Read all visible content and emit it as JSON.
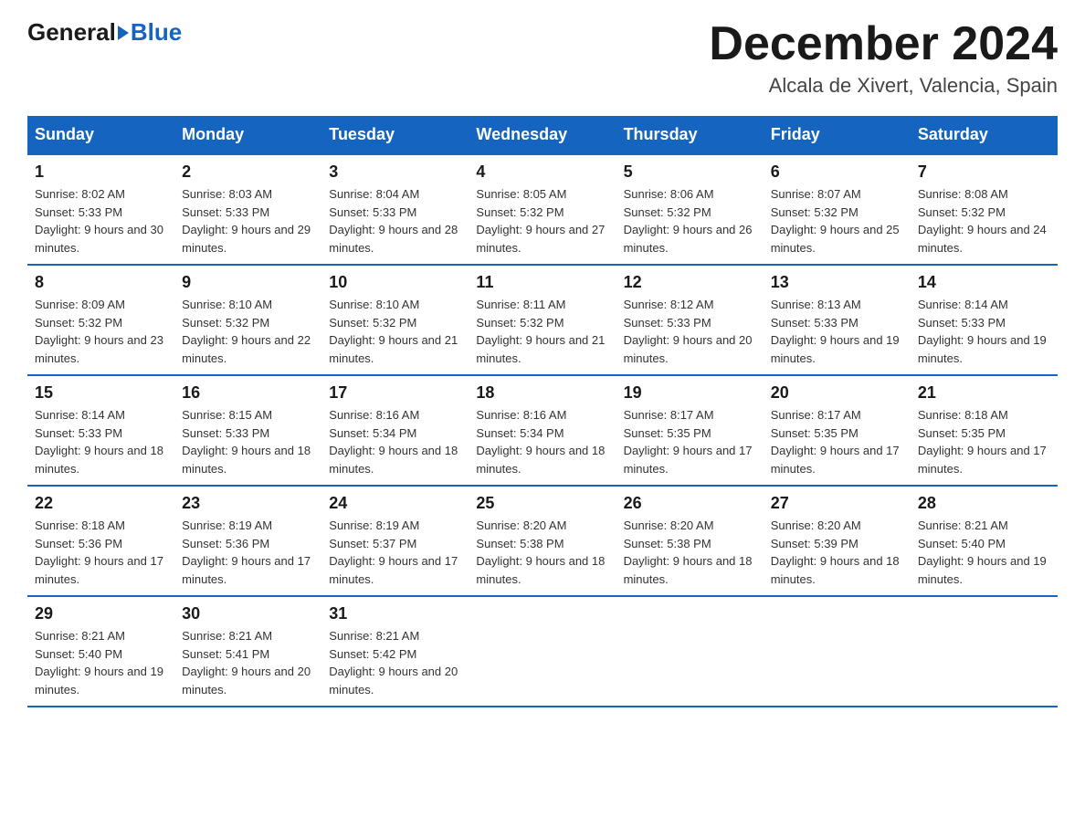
{
  "logo": {
    "general": "General",
    "blue": "Blue",
    "tagline": "Blue"
  },
  "header": {
    "title": "December 2024",
    "subtitle": "Alcala de Xivert, Valencia, Spain"
  },
  "days_of_week": [
    "Sunday",
    "Monday",
    "Tuesday",
    "Wednesday",
    "Thursday",
    "Friday",
    "Saturday"
  ],
  "weeks": [
    [
      {
        "day": "1",
        "sunrise": "8:02 AM",
        "sunset": "5:33 PM",
        "daylight": "9 hours and 30 minutes."
      },
      {
        "day": "2",
        "sunrise": "8:03 AM",
        "sunset": "5:33 PM",
        "daylight": "9 hours and 29 minutes."
      },
      {
        "day": "3",
        "sunrise": "8:04 AM",
        "sunset": "5:33 PM",
        "daylight": "9 hours and 28 minutes."
      },
      {
        "day": "4",
        "sunrise": "8:05 AM",
        "sunset": "5:32 PM",
        "daylight": "9 hours and 27 minutes."
      },
      {
        "day": "5",
        "sunrise": "8:06 AM",
        "sunset": "5:32 PM",
        "daylight": "9 hours and 26 minutes."
      },
      {
        "day": "6",
        "sunrise": "8:07 AM",
        "sunset": "5:32 PM",
        "daylight": "9 hours and 25 minutes."
      },
      {
        "day": "7",
        "sunrise": "8:08 AM",
        "sunset": "5:32 PM",
        "daylight": "9 hours and 24 minutes."
      }
    ],
    [
      {
        "day": "8",
        "sunrise": "8:09 AM",
        "sunset": "5:32 PM",
        "daylight": "9 hours and 23 minutes."
      },
      {
        "day": "9",
        "sunrise": "8:10 AM",
        "sunset": "5:32 PM",
        "daylight": "9 hours and 22 minutes."
      },
      {
        "day": "10",
        "sunrise": "8:10 AM",
        "sunset": "5:32 PM",
        "daylight": "9 hours and 21 minutes."
      },
      {
        "day": "11",
        "sunrise": "8:11 AM",
        "sunset": "5:32 PM",
        "daylight": "9 hours and 21 minutes."
      },
      {
        "day": "12",
        "sunrise": "8:12 AM",
        "sunset": "5:33 PM",
        "daylight": "9 hours and 20 minutes."
      },
      {
        "day": "13",
        "sunrise": "8:13 AM",
        "sunset": "5:33 PM",
        "daylight": "9 hours and 19 minutes."
      },
      {
        "day": "14",
        "sunrise": "8:14 AM",
        "sunset": "5:33 PM",
        "daylight": "9 hours and 19 minutes."
      }
    ],
    [
      {
        "day": "15",
        "sunrise": "8:14 AM",
        "sunset": "5:33 PM",
        "daylight": "9 hours and 18 minutes."
      },
      {
        "day": "16",
        "sunrise": "8:15 AM",
        "sunset": "5:33 PM",
        "daylight": "9 hours and 18 minutes."
      },
      {
        "day": "17",
        "sunrise": "8:16 AM",
        "sunset": "5:34 PM",
        "daylight": "9 hours and 18 minutes."
      },
      {
        "day": "18",
        "sunrise": "8:16 AM",
        "sunset": "5:34 PM",
        "daylight": "9 hours and 18 minutes."
      },
      {
        "day": "19",
        "sunrise": "8:17 AM",
        "sunset": "5:35 PM",
        "daylight": "9 hours and 17 minutes."
      },
      {
        "day": "20",
        "sunrise": "8:17 AM",
        "sunset": "5:35 PM",
        "daylight": "9 hours and 17 minutes."
      },
      {
        "day": "21",
        "sunrise": "8:18 AM",
        "sunset": "5:35 PM",
        "daylight": "9 hours and 17 minutes."
      }
    ],
    [
      {
        "day": "22",
        "sunrise": "8:18 AM",
        "sunset": "5:36 PM",
        "daylight": "9 hours and 17 minutes."
      },
      {
        "day": "23",
        "sunrise": "8:19 AM",
        "sunset": "5:36 PM",
        "daylight": "9 hours and 17 minutes."
      },
      {
        "day": "24",
        "sunrise": "8:19 AM",
        "sunset": "5:37 PM",
        "daylight": "9 hours and 17 minutes."
      },
      {
        "day": "25",
        "sunrise": "8:20 AM",
        "sunset": "5:38 PM",
        "daylight": "9 hours and 18 minutes."
      },
      {
        "day": "26",
        "sunrise": "8:20 AM",
        "sunset": "5:38 PM",
        "daylight": "9 hours and 18 minutes."
      },
      {
        "day": "27",
        "sunrise": "8:20 AM",
        "sunset": "5:39 PM",
        "daylight": "9 hours and 18 minutes."
      },
      {
        "day": "28",
        "sunrise": "8:21 AM",
        "sunset": "5:40 PM",
        "daylight": "9 hours and 19 minutes."
      }
    ],
    [
      {
        "day": "29",
        "sunrise": "8:21 AM",
        "sunset": "5:40 PM",
        "daylight": "9 hours and 19 minutes."
      },
      {
        "day": "30",
        "sunrise": "8:21 AM",
        "sunset": "5:41 PM",
        "daylight": "9 hours and 20 minutes."
      },
      {
        "day": "31",
        "sunrise": "8:21 AM",
        "sunset": "5:42 PM",
        "daylight": "9 hours and 20 minutes."
      },
      null,
      null,
      null,
      null
    ]
  ]
}
